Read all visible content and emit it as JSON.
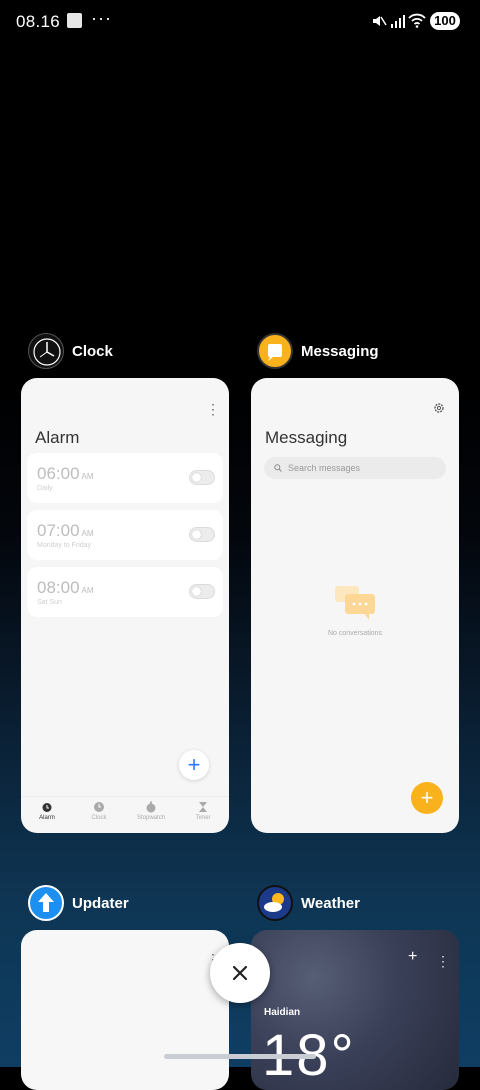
{
  "status_bar": {
    "time": "08.16",
    "battery": "100"
  },
  "apps": [
    {
      "name": "Clock"
    },
    {
      "name": "Messaging"
    },
    {
      "name": "Updater"
    },
    {
      "name": "Weather"
    }
  ],
  "clock": {
    "title": "Alarm",
    "alarms": [
      {
        "time": "06:00",
        "ampm": "AM",
        "repeat": "Daily"
      },
      {
        "time": "07:00",
        "ampm": "AM",
        "repeat": "Monday to Friday"
      },
      {
        "time": "08:00",
        "ampm": "AM",
        "repeat": "Sat Sun"
      }
    ],
    "tabs": [
      "Alarm",
      "Clock",
      "Stopwatch",
      "Timer"
    ],
    "add_symbol": "+"
  },
  "messaging": {
    "title": "Messaging",
    "search_placeholder": "Search messages",
    "empty_text": "No conversations",
    "add_symbol": "+"
  },
  "weather": {
    "city": "Haidian",
    "temperature": "18°"
  },
  "colors": {
    "accent_blue": "#2a7bff",
    "messaging_orange": "#f9b11c"
  }
}
